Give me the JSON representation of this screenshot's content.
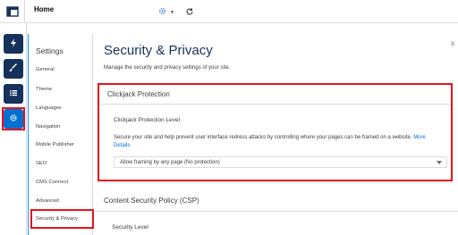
{
  "topbar": {
    "tab_label": "Home",
    "gear_icon": "gear-icon",
    "refresh_icon": "refresh-icon"
  },
  "rail": {
    "items": [
      {
        "icon": "lightning-icon"
      },
      {
        "icon": "brush-icon"
      },
      {
        "icon": "list-icon"
      },
      {
        "icon": "gear-icon",
        "active": true
      }
    ]
  },
  "sidebar": {
    "title": "Settings",
    "items": [
      {
        "label": "General"
      },
      {
        "label": "Theme"
      },
      {
        "label": "Languages"
      },
      {
        "label": "Navigation"
      },
      {
        "label": "Mobile Publisher"
      },
      {
        "label": "SEO"
      },
      {
        "label": "CMS Connect"
      },
      {
        "label": "Advanced"
      },
      {
        "label": "Security & Privacy",
        "selected": true
      }
    ]
  },
  "main": {
    "title": "Security & Privacy",
    "description": "Manage the security and privacy settings of your site.",
    "clickjack": {
      "heading": "Clickjack Protection",
      "field_label": "Clickjack Protection Level",
      "help_text": "Secure your site and help prevent user interface redress attacks by controlling where your pages can be framed on a website.",
      "help_link": "More Details",
      "selected_value": "Allow framing by any page (No protection)"
    },
    "csp": {
      "heading": "Content Security Policy (CSP)",
      "field_label": "Security Level"
    }
  },
  "colors": {
    "accent": "#0070d2",
    "rail_dark": "#16325c",
    "highlight": "#e5131d"
  }
}
